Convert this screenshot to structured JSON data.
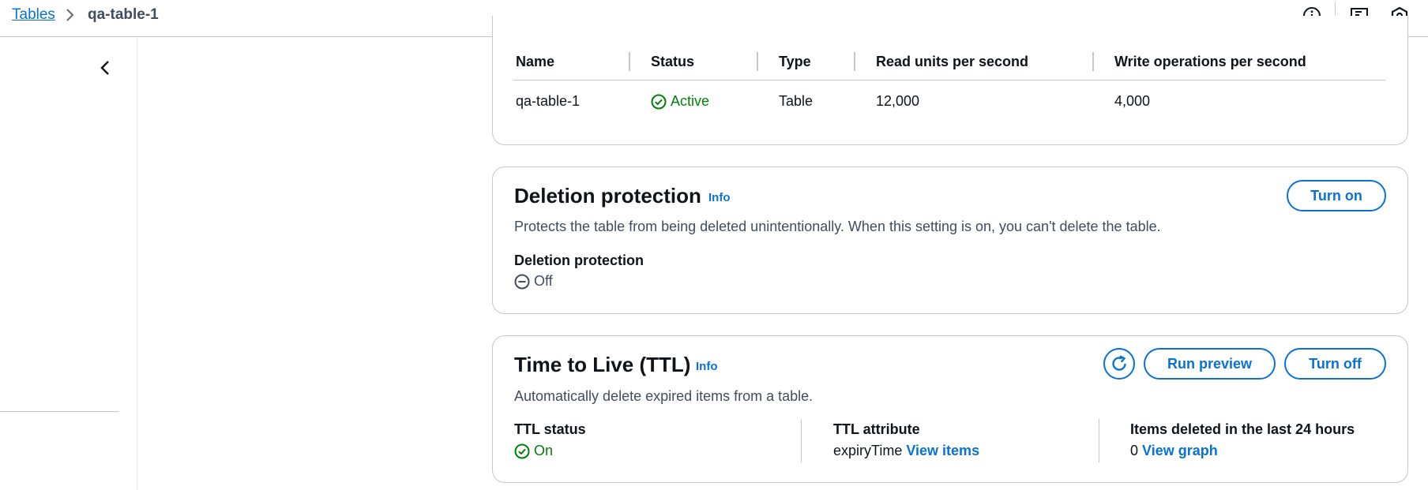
{
  "breadcrumb": {
    "parent": "Tables",
    "current": "qa-table-1"
  },
  "topbar_icons": [
    "info-icon",
    "feedback-icon",
    "settings-hexagon-icon"
  ],
  "table": {
    "headers": [
      "Name",
      "Status",
      "Type",
      "Read units per second",
      "Write operations per second"
    ],
    "rows": [
      {
        "name": "qa-table-1",
        "status": "Active",
        "type": "Table",
        "read": "12,000",
        "write": "4,000"
      }
    ]
  },
  "deletion_protection": {
    "title": "Deletion protection",
    "info": "Info",
    "description": "Protects the table from being deleted unintentionally. When this setting is on, you can't delete the table.",
    "button": "Turn on",
    "field_label": "Deletion protection",
    "field_value": "Off"
  },
  "ttl": {
    "title": "Time to Live (TTL)",
    "info": "Info",
    "description": "Automatically delete expired items from a table.",
    "run_preview": "Run preview",
    "turn_off": "Turn off",
    "status_label": "TTL status",
    "status_value": "On",
    "attribute_label": "TTL attribute",
    "attribute_value": "expiryTime",
    "view_items": "View items",
    "deleted_label": "Items deleted in the last 24 hours",
    "deleted_value": "0",
    "view_graph": "View graph"
  },
  "colors": {
    "link": "#0972d3",
    "success": "#037f0c",
    "border": "#c6c6cd",
    "text": "#0f141a"
  }
}
